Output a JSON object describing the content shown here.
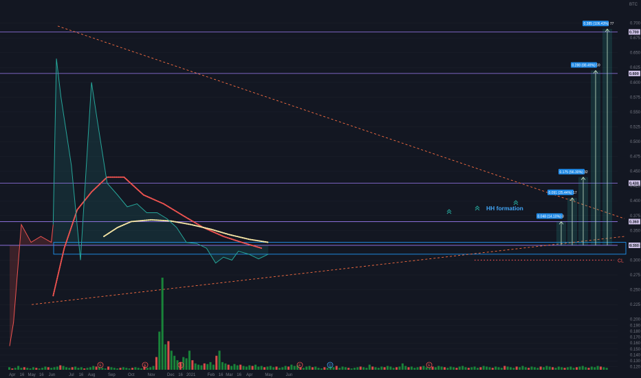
{
  "chart_data": {
    "type": "line",
    "currency": "BTC",
    "ylim": [
      0.115,
      0.725
    ],
    "y_ticks": [
      0.7,
      0.675,
      0.65,
      0.625,
      0.6,
      0.575,
      0.55,
      0.525,
      0.5,
      0.475,
      0.45,
      0.425,
      0.4,
      0.375,
      0.35,
      0.325,
      0.3,
      0.275,
      0.25,
      0.225,
      0.2,
      0.19,
      0.18,
      0.17,
      0.16,
      0.15,
      0.14,
      0.13,
      0.12
    ],
    "x_ticks": [
      "Apr",
      "16",
      "May",
      "16",
      "Jun",
      "Jul",
      "16",
      "Aug",
      "Sep",
      "Oct",
      "Nov",
      "Dec",
      "16",
      "2021",
      "Feb",
      "16",
      "Mar",
      "16",
      "Apr",
      "May",
      "Jun"
    ],
    "price_series": {
      "name": "price",
      "x": [
        "Mar 28",
        "Apr 3",
        "Apr 15",
        "Apr 30",
        "May 15",
        "May 31",
        "Jun 3",
        "Jun 8",
        "Jun 15",
        "Jul 1",
        "Jul 15",
        "Aug 1",
        "Aug 10",
        "Aug 25",
        "Sep 10",
        "Sep 25",
        "Oct 10",
        "Oct 25",
        "Nov 10",
        "Nov 25",
        "Dec 10",
        "Dec 25",
        "Jan 10",
        "Jan 25",
        "Feb 8",
        "Feb 20",
        "Mar 5",
        "Mar 15",
        "Mar 31",
        "Apr 15",
        "Apr 30"
      ],
      "y": [
        0.155,
        0.195,
        0.36,
        0.33,
        0.34,
        0.33,
        0.36,
        0.64,
        0.575,
        0.46,
        0.3,
        0.6,
        0.535,
        0.43,
        0.41,
        0.39,
        0.395,
        0.38,
        0.38,
        0.37,
        0.355,
        0.33,
        0.328,
        0.32,
        0.295,
        0.305,
        0.3,
        0.315,
        0.31,
        0.302,
        0.31
      ]
    },
    "ma_series": [
      {
        "color": "#ef5350",
        "x": [
          "Jun 3",
          "Jun 20",
          "Jul 10",
          "Aug 1",
          "Aug 25",
          "Sep 20",
          "Oct 20",
          "Nov 20",
          "Dec 20",
          "Jan 20",
          "Feb 20",
          "Mar 20",
          "Apr 20"
        ],
        "y": [
          0.24,
          0.32,
          0.385,
          0.415,
          0.44,
          0.44,
          0.41,
          0.395,
          0.375,
          0.355,
          0.34,
          0.33,
          0.32
        ]
      },
      {
        "color": "#f7e7a6",
        "x": [
          "Aug 20",
          "Sep 10",
          "Oct 1",
          "Nov 1",
          "Dec 1",
          "Jan 1",
          "Feb 1",
          "Mar 1",
          "Apr 1",
          "Apr 30"
        ],
        "y": [
          0.34,
          0.355,
          0.365,
          0.368,
          0.366,
          0.36,
          0.352,
          0.343,
          0.335,
          0.33
        ]
      }
    ],
    "horizontal_levels": [
      {
        "value": 0.685,
        "label": "0.700"
      },
      {
        "value": 0.615,
        "label": "0.600"
      },
      {
        "value": 0.43,
        "label": "0.430"
      },
      {
        "value": 0.365,
        "label": "0.360"
      },
      {
        "value": 0.325,
        "label": "0.330"
      }
    ],
    "support_zone": [
      0.31,
      0.33
    ],
    "trend_lines": [
      {
        "from": [
          "Jun 10",
          0.695
        ],
        "to": [
          "Jun 30 end",
          0.37
        ]
      },
      {
        "from": [
          "May 1",
          0.225
        ],
        "to": [
          "Jun 30 end",
          0.34
        ]
      }
    ],
    "close_line": {
      "value": 0.3,
      "label": "CL"
    },
    "targets": [
      {
        "label": "0.385 (106.43%) 77",
        "value": 0.69
      },
      {
        "label": "0.288 (88.49%) 59",
        "value": 0.62
      },
      {
        "label": "0.175 (56.30%) 32",
        "value": 0.44
      },
      {
        "label": "0.091 (25.44%) 17",
        "value": 0.405
      },
      {
        "label": "0.048 (14.10%) 8",
        "value": 0.365
      }
    ],
    "annotations": [
      "HH formation"
    ],
    "volume": [
      4,
      2,
      3,
      6,
      3,
      4,
      3,
      2,
      4,
      3,
      2,
      3,
      5,
      4,
      3,
      4,
      5,
      7,
      6,
      4,
      3,
      4,
      5,
      3,
      4,
      2,
      3,
      4,
      6,
      5,
      4,
      3,
      2,
      5,
      4,
      3,
      2,
      3,
      4,
      3,
      2,
      3,
      4,
      3,
      2,
      5,
      3,
      4,
      6,
      20,
      60,
      145,
      40,
      45,
      30,
      22,
      15,
      12,
      20,
      18,
      30,
      15,
      10,
      8,
      7,
      10,
      9,
      12,
      8,
      22,
      30,
      12,
      10,
      8,
      6,
      9,
      7,
      8,
      6,
      5,
      7,
      6,
      8,
      5,
      6,
      4,
      5,
      6,
      4,
      5,
      3,
      4,
      6,
      5,
      8,
      6,
      7,
      4,
      3,
      5,
      6,
      4,
      5,
      3,
      2,
      4,
      3,
      5,
      4,
      6,
      3,
      5,
      4,
      3,
      2,
      3,
      4,
      5,
      4,
      3,
      8,
      5,
      4,
      3,
      5,
      4,
      6,
      5,
      3,
      4,
      5,
      10,
      6,
      4,
      5,
      3,
      4,
      5,
      6,
      4,
      3,
      5,
      4,
      6,
      5,
      4,
      3,
      5,
      4,
      3,
      5,
      6,
      4,
      3,
      4,
      5,
      3,
      4,
      6,
      5,
      4,
      3,
      5,
      4,
      3,
      6,
      5,
      4,
      3,
      5,
      4,
      6,
      4,
      3,
      5,
      4,
      3,
      5,
      4,
      6,
      5,
      4,
      3,
      5,
      4,
      3,
      4,
      5,
      3,
      4,
      5,
      6,
      4,
      3,
      5,
      4,
      6,
      5,
      4,
      3
    ],
    "event_markers": [
      "E",
      "E",
      "E",
      "E",
      "D",
      "E"
    ]
  },
  "colors": {
    "background": "#131722",
    "grid": "#1e222d",
    "price_up": "#26a69a",
    "price_down": "#ef5350",
    "level_line": "#9c7cf4",
    "zone": "#2196f3",
    "trend": "#ff7043",
    "target_box": "#1e88e5",
    "volume": "#26a69a"
  }
}
